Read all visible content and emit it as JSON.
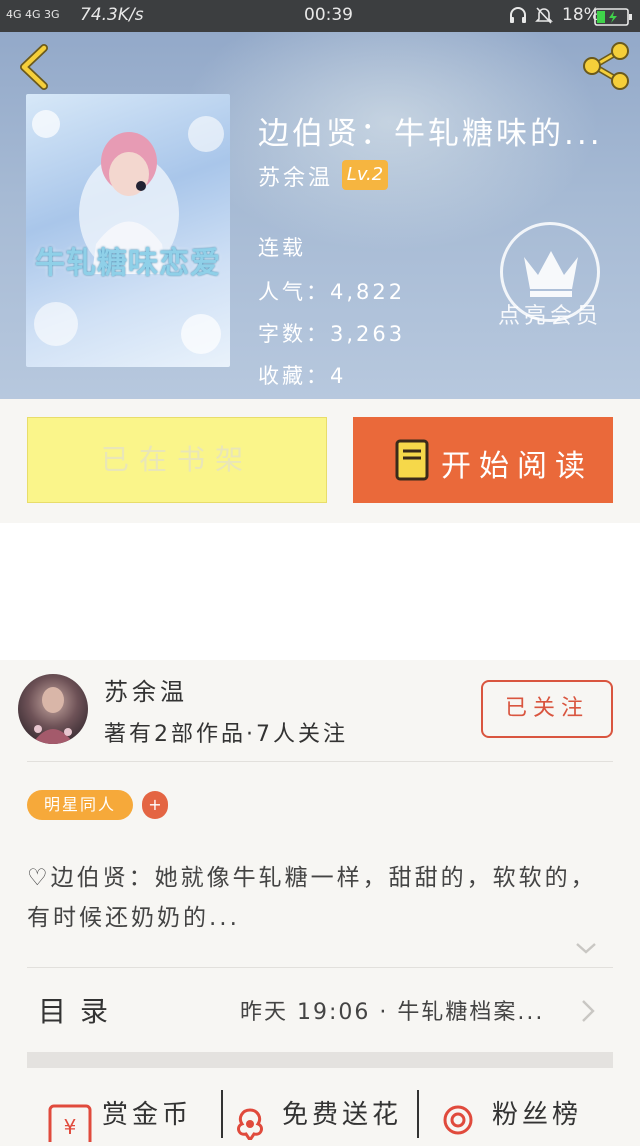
{
  "status_bar": {
    "network": "4G 4G 3G",
    "speed": "74.3K/s",
    "time": "00:39",
    "battery": "18%"
  },
  "book": {
    "title": "边伯贤：牛轧糖味的...",
    "author": "苏余温",
    "level": "Lv.2",
    "status": "连载",
    "popularity_label": "人气：",
    "popularity": "4,822",
    "word_count_label": "字数：",
    "word_count": "3,263",
    "favorites_label": "收藏：",
    "favorites": "4",
    "vip_label": "点亮会员",
    "cover_text": "牛轧糖味恋爱"
  },
  "actions": {
    "in_shelf": "已在书架",
    "start_reading": "开始阅读"
  },
  "author_card": {
    "name": "苏余温",
    "stats": "著有2部作品·7人关注",
    "follow": "已关注"
  },
  "tags": {
    "primary": "明星同人",
    "add": "+"
  },
  "description": "♡边伯贤：她就像牛轧糖一样，甜甜的，软软的，有时候还奶奶的...",
  "toc": {
    "label": "目录",
    "latest": "昨天 19:06 · 牛轧糖档案..."
  },
  "bottom_bar": {
    "reward": "赏金币",
    "flowers": "免费送花",
    "fans": "粉丝榜"
  },
  "colors": {
    "accent_orange": "#ea693a",
    "shelf_yellow": "#faf58a",
    "tag_orange": "#f6a93a",
    "follow_red": "#d9553f"
  }
}
